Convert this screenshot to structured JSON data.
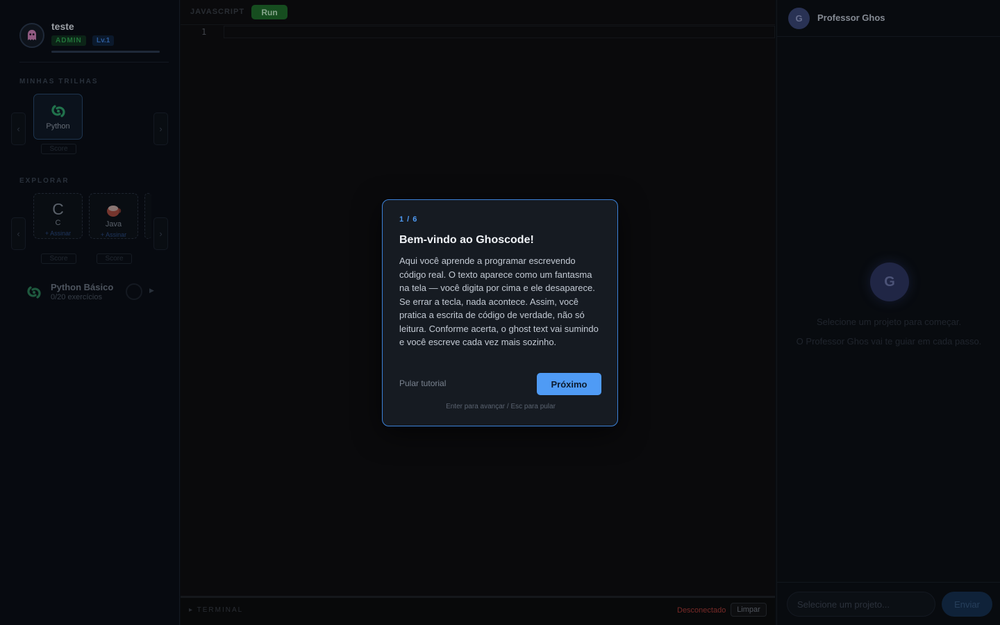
{
  "profile": {
    "username": "teste",
    "role_badge": "ADMIN",
    "level_badge": "Lv.1"
  },
  "sidebar": {
    "my_tracks_title": "MINHAS TRILHAS",
    "my_tracks": [
      {
        "label": "Python",
        "score_label": "Score"
      }
    ],
    "explore_title": "EXPLORAR",
    "explore": [
      {
        "label": "C",
        "action": "+ Assinar",
        "score_label": "Score",
        "icon": "c-letter-icon"
      },
      {
        "label": "Java",
        "action": "+ Assinar",
        "score_label": "Score",
        "icon": "coffee-cup-icon"
      }
    ],
    "arrow_left": "‹",
    "arrow_right": "›",
    "course": {
      "title": "Python Básico",
      "subtitle": "0/20 exercícios",
      "play_glyph": "▶"
    }
  },
  "editor": {
    "language": "JAVASCRIPT",
    "run_label": "Run",
    "line_number": "1",
    "terminal_label": "▸ TERMINAL",
    "terminal_status": "Desconectado",
    "terminal_clear": "Limpar"
  },
  "chat": {
    "avatar_letter": "G",
    "title": "Professor Ghos",
    "empty_line_1": "Selecione um projeto para começar.",
    "empty_line_2": "O Professor Ghos vai te guiar em cada passo.",
    "input_placeholder": "Selecione um projeto...",
    "send_label": "Enviar"
  },
  "tutorial": {
    "step": "1 / 6",
    "title": "Bem-vindo ao Ghoscode!",
    "body": "Aqui você aprende a programar escrevendo código real. O texto aparece como um fantasma na tela — você digita por cima e ele desaparece. Se errar a tecla, nada acontece. Assim, você pratica a escrita de código de verdade, não só leitura. Conforme acerta, o ghost text vai sumindo e você escreve cada vez mais sozinho.",
    "skip_label": "Pular tutorial",
    "next_label": "Próximo",
    "hint": "Enter para avançar / Esc para pular"
  },
  "colors": {
    "accent": "#4f9bf5",
    "run_green": "#1f6b2c",
    "disconnected_red": "#a53a36",
    "python_green": "#2e9e6a"
  }
}
